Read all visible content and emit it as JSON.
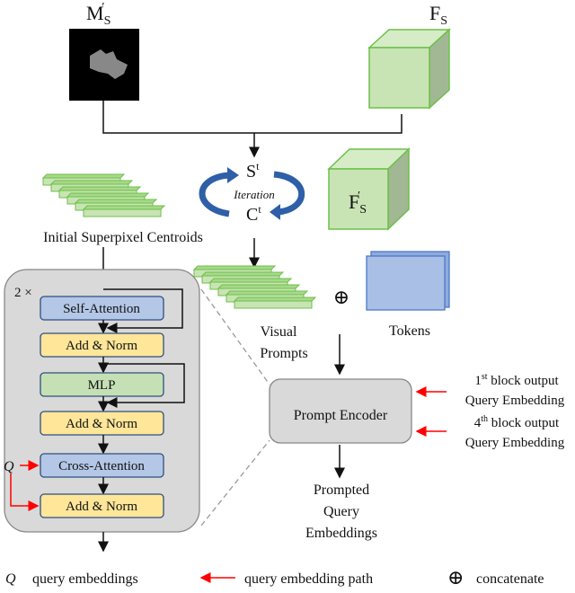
{
  "inputs": {
    "mask_label": "M",
    "mask_sub": "S",
    "mask_prime": "′",
    "features_label": "F",
    "features_sub": "S",
    "refined_features_label": "F",
    "refined_features_sub": "S",
    "refined_features_prime": "′"
  },
  "iteration": {
    "s_label": "S",
    "c_label": "C",
    "sup": "t",
    "label": "Iteration"
  },
  "centroids": {
    "label": "Initial Superpixel Centroids"
  },
  "transformer": {
    "repeat_label": "2 ×",
    "blocks": [
      "Self-Attention",
      "Add & Norm",
      "MLP",
      "Add & Norm",
      "Cross-Attention",
      "Add & Norm"
    ],
    "q_label": "Q"
  },
  "visual_prompts": {
    "line1": "Visual",
    "line2": "Prompts"
  },
  "concat_symbol": "⊕",
  "tokens": {
    "label": "Tokens"
  },
  "prompt_encoder": {
    "label": "Prompt Encoder"
  },
  "side_inputs": [
    {
      "ordinal": "1",
      "sup": "st",
      "line1": " block output",
      "line2": "Query Embedding"
    },
    {
      "ordinal": "4",
      "sup": "th",
      "line1": " block output",
      "line2": "Query Embedding"
    }
  ],
  "output": {
    "line1": "Prompted",
    "line2": "Query",
    "line3": "Embeddings"
  },
  "legend": {
    "q_symbol": "Q",
    "q_text": "query embeddings",
    "path_text": "query embedding path",
    "concat_symbol": "⊕",
    "concat_text": "concatenate"
  },
  "colors": {
    "attention": "#b4c7e7",
    "add_norm": "#ffe699",
    "mlp": "#c5e0b4",
    "feature_cube": "#c9e4b4",
    "cube_edge": "#6cc04a",
    "tokens": "#a9bfe6",
    "path_red": "#ff0000",
    "iteration_blue": "#2e5fa8",
    "panel_gray": "#d9d9d9"
  }
}
